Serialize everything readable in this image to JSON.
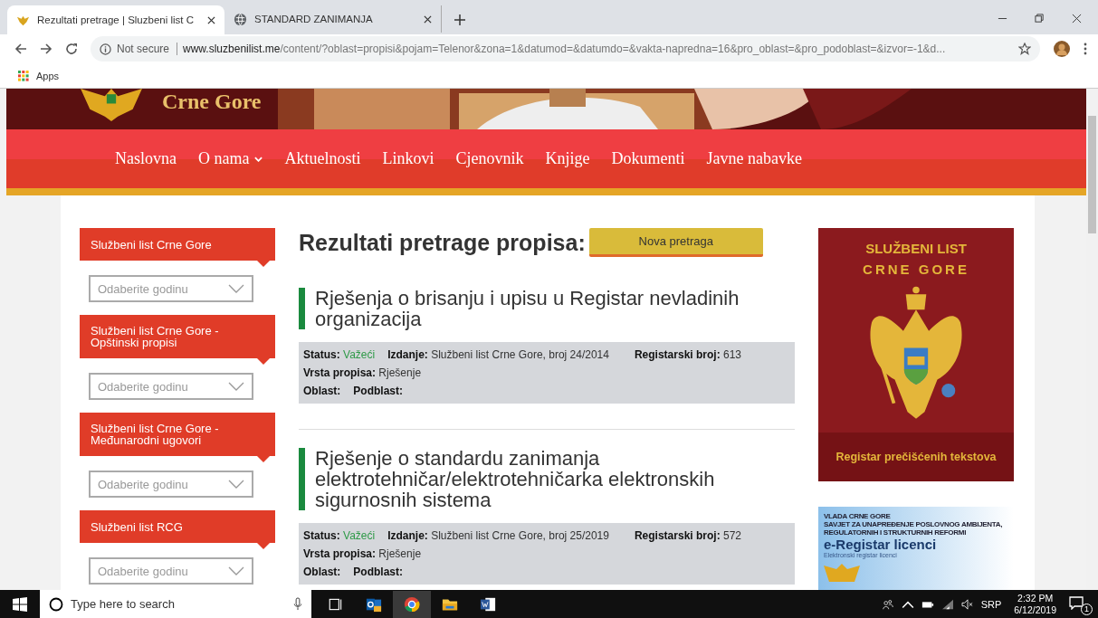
{
  "browser": {
    "tabs": [
      {
        "title": "Rezultati pretrage | Sluzbeni list C",
        "selected": true,
        "kind": "emblem"
      },
      {
        "title": "STANDARD ZANIMANJA",
        "selected": false,
        "kind": "globe"
      }
    ],
    "address": {
      "security": "Not secure",
      "host": "www.sluzbenilist.me",
      "path": "/content/?oblast=propisi&pojam=Telenor&zona=1&datumod=&datumdo=&vakta-napredna=16&pro_oblast=&pro_podoblast=&izvor=-1&d..."
    },
    "bookmarks": [
      "Apps"
    ]
  },
  "site": {
    "logo_text": "Crne Gore",
    "nav": [
      {
        "label": "Naslovna",
        "dropdown": false
      },
      {
        "label": "O nama",
        "dropdown": true
      },
      {
        "label": "Aktuelnosti",
        "dropdown": false
      },
      {
        "label": "Linkovi",
        "dropdown": false
      },
      {
        "label": "Cjenovnik",
        "dropdown": false
      },
      {
        "label": "Knjige",
        "dropdown": false
      },
      {
        "label": "Dokumenti",
        "dropdown": false
      },
      {
        "label": "Javne nabavke",
        "dropdown": false
      }
    ],
    "sidebar": [
      {
        "title": "Službeni list Crne Gore",
        "placeholder": "Odaberite godinu"
      },
      {
        "title": "Službeni list Crne Gore - Opštinski propisi",
        "placeholder": "Odaberite godinu"
      },
      {
        "title": "Službeni list Crne Gore - Međunarodni ugovori",
        "placeholder": "Odaberite godinu"
      },
      {
        "title": "Službeni list RCG",
        "placeholder": "Odaberite godinu"
      }
    ],
    "results": {
      "heading": "Rezultati pretrage propisa:",
      "new_search": "Nova pretraga",
      "items": [
        {
          "title": "Rješenja o brisanju i upisu u Registar nevladinih organizacija",
          "status_label": "Status:",
          "status": "Važeći",
          "izdanje_label": "Izdanje:",
          "izdanje": "Službeni list Crne Gore, broj 24/2014",
          "broj_label": "Registarski broj:",
          "broj": "613",
          "vrsta_label": "Vrsta propisa:",
          "vrsta": "Rješenje",
          "oblast_label": "Oblast:",
          "podblast_label": "Podblast:"
        },
        {
          "title": "Rješenje o standardu zanimanja elektrotehničar/elektrotehničarka elektronskih sigurnosnih sistema",
          "status_label": "Status:",
          "status": "Važeći",
          "izdanje_label": "Izdanje:",
          "izdanje": "Službeni list Crne Gore, broj 25/2019",
          "broj_label": "Registarski broj:",
          "broj": "572",
          "vrsta_label": "Vrsta propisa:",
          "vrsta": "Rješenje",
          "oblast_label": "Oblast:",
          "podblast_label": "Podblast:"
        }
      ]
    },
    "promo": {
      "title_lines": [
        "SLUŽBENI LIST",
        "CRNE GORE"
      ],
      "footer": "Registar prečišćenih tekstova"
    },
    "eregistar": {
      "org_lines": [
        "VLADA CRNE GORE",
        "SAVJET ZA UNAPREĐENJE POSLOVNOG AMBIJENTA,",
        "REGULATORNIH I STRUKTURNIH REFORMI"
      ],
      "title": "e-Registar licenci",
      "subtitle": "Elektronski registar licenci"
    }
  },
  "taskbar": {
    "search_placeholder": "Type here to search",
    "language": "SRP",
    "time": "2:32 PM",
    "date": "6/12/2019",
    "notifications": "1"
  }
}
